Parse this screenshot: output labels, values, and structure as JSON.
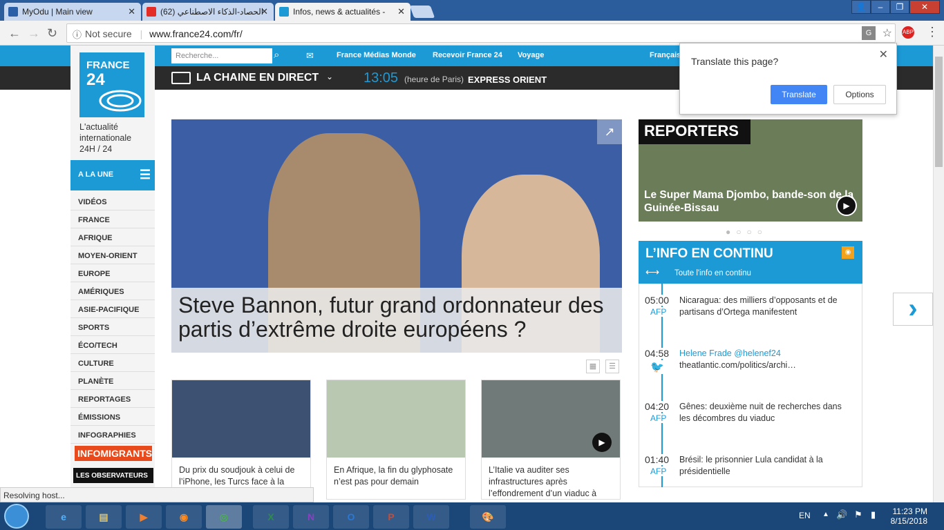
{
  "tabs": [
    {
      "label": "MyOdu | Main view"
    },
    {
      "label": "(62) الحصاد-الذكاء الاصطناعي"
    },
    {
      "label": "Infos, news & actualités -"
    }
  ],
  "address": {
    "security": "Not secure",
    "url": "www.france24.com/fr/"
  },
  "site": {
    "search_placeholder": "Recherche...",
    "top_links": [
      "France Médias Monde",
      "Recevoir France 24",
      "Voyage",
      "Français"
    ],
    "live": "LA CHAINE EN DIRECT",
    "time": "13:05",
    "time_note": "(heure de Paris)",
    "program": "EXPRESS ORIENT",
    "logo_line1": "FRANCE",
    "logo_line2": "24",
    "tagline": "L'actualité internationale 24H / 24",
    "alaune": "A LA UNE",
    "menu": [
      "VIDÉOS",
      "FRANCE",
      "AFRIQUE",
      "MOYEN-ORIENT",
      "EUROPE",
      "AMÉRIQUES",
      "ASIE-PACIFIQUE",
      "SPORTS",
      "ÉCO/TECH",
      "CULTURE",
      "PLANÈTE",
      "REPORTAGES",
      "ÉMISSIONS",
      "INFOGRAPHIES"
    ],
    "infomigrants": "INFOMIGRANTS",
    "observateurs": "LES OBSERVATEURS",
    "hero_title": "Steve Bannon, futur grand ordonnateur des partis d’extrême droite européens ?",
    "cards": [
      {
        "text": "Du prix du soudjouk à celui de l’iPhone, les Turcs face à la"
      },
      {
        "text": "En Afrique, la fin du glyphosate n’est pas pour demain"
      },
      {
        "text": "L’Italie va auditer ses infrastructures après l’effondrement d’un viaduc à"
      }
    ],
    "reporters_logo": "REPORTERS",
    "reporters_caption": "Le Super Mama Djombo, bande-son de la Guinée-Bissau",
    "info_title": "L’INFO EN CONTINU",
    "info_sub": "Toute l'info en continu",
    "feed": [
      {
        "time": "05:00",
        "src": "AFP",
        "text": "Nicaragua: des milliers d’opposants et de partisans d’Ortega manifestent"
      },
      {
        "time": "04:58",
        "src": "",
        "text": "Helene Frade @helenef24",
        "text2": "theatlantic.com/politics/archi…"
      },
      {
        "time": "04:20",
        "src": "AFP",
        "text": "Gênes: deuxième nuit de recherches dans les décombres du viaduc"
      },
      {
        "time": "01:40",
        "src": "AFP",
        "text": "Brésil: le prisonnier Lula candidat à la présidentielle"
      }
    ]
  },
  "translate": {
    "question": "Translate this page?",
    "translate_btn": "Translate",
    "options_btn": "Options"
  },
  "status": "Resolving host...",
  "taskbar": {
    "lang": "EN",
    "time": "11:23 PM",
    "date": "8/15/2018"
  }
}
